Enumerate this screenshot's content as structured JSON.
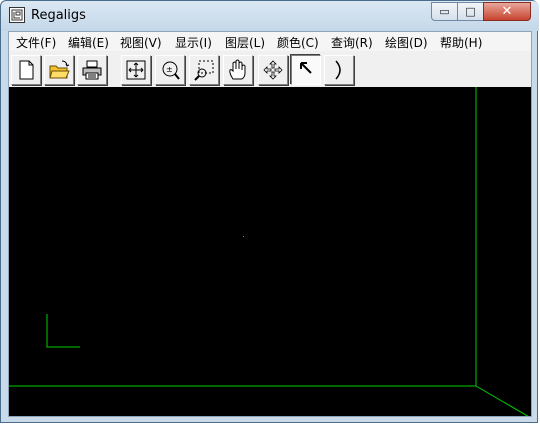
{
  "window": {
    "title": "Regaligs",
    "controls": {
      "minimize": "▭",
      "maximize": "□",
      "close": "✕"
    }
  },
  "menu": [
    "文件(F)",
    "编辑(E)",
    "视图(V)",
    "显示(I)",
    "图层(L)",
    "颜色(C)",
    "查询(R)",
    "绘图(D)",
    "帮助(H)"
  ],
  "toolbar": [
    {
      "icon": "new-file-icon"
    },
    {
      "icon": "open-folder-icon"
    },
    {
      "icon": "print-icon"
    },
    {
      "icon": "zoom-extents-icon"
    },
    {
      "icon": "zoom-realtime-icon"
    },
    {
      "icon": "zoom-window-icon"
    },
    {
      "icon": "pan-hand-icon"
    },
    {
      "icon": "move-cross-icon"
    },
    {
      "icon": "select-arrow-icon",
      "pressed": true
    },
    {
      "icon": "arc-icon"
    }
  ],
  "canvas": {
    "background": "#000000",
    "line_color": "#00cc00"
  }
}
